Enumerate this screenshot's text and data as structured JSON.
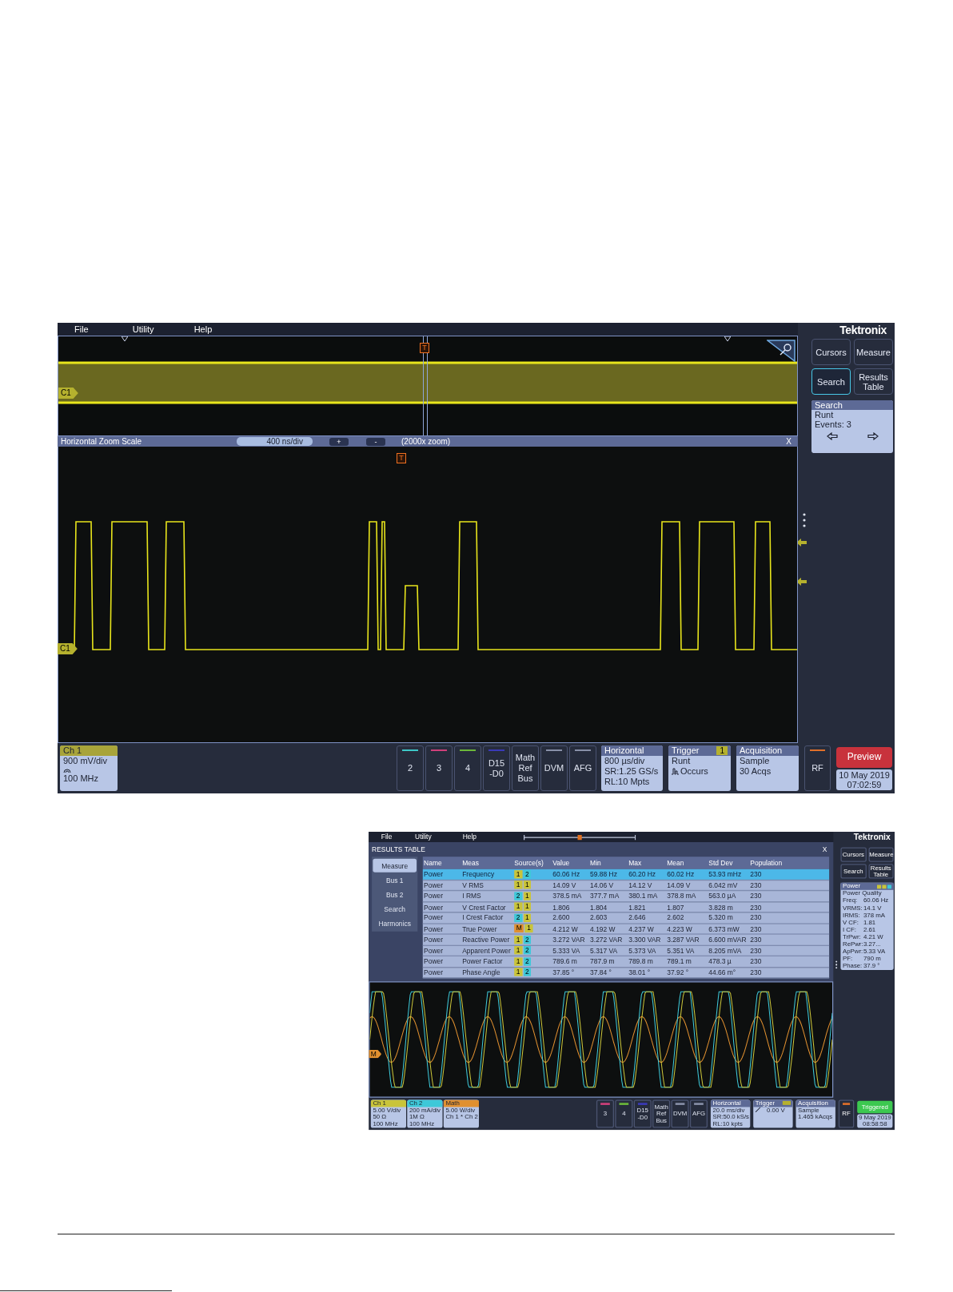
{
  "scope": {
    "menu": [
      "File",
      "Utility",
      "Help"
    ],
    "logo": "Tektronix",
    "overview": {
      "channel": "C1",
      "trigger": "T"
    },
    "zoom_bar": {
      "title": "Horizontal Zoom Scale",
      "scale": "400 ns/div",
      "plus": "+",
      "minus": "-",
      "factor": "(2000x zoom)",
      "close": "X"
    },
    "zoom": {
      "channel": "C1",
      "trigger": "T"
    },
    "side_buttons": [
      {
        "label": "Cursors",
        "selected": false
      },
      {
        "label": "Measure",
        "selected": false
      },
      {
        "label": "Search",
        "selected": true
      },
      {
        "label": "Results Table",
        "selected": false
      }
    ],
    "search_panel": {
      "title": "Search",
      "lines": [
        "Runt",
        "Events: 3"
      ]
    },
    "channel": {
      "title": "Ch 1",
      "scale": "900 mV/div",
      "bandwidth": "100 MHz"
    },
    "buttons": [
      {
        "lines": [
          "2"
        ],
        "color": "#3ec8c8"
      },
      {
        "lines": [
          "3"
        ],
        "color": "#d0407a"
      },
      {
        "lines": [
          "4"
        ],
        "color": "#6cb83a"
      },
      {
        "lines": [
          "D15",
          "-D0"
        ],
        "color": "#3a3ab8"
      },
      {
        "lines": [
          "Math",
          "Ref",
          "Bus"
        ]
      },
      {
        "lines": [
          "DVM"
        ],
        "color": "#8890a8"
      },
      {
        "lines": [
          "AFG"
        ],
        "color": "#8890a8"
      }
    ],
    "panels": [
      {
        "kind": "plain",
        "title": "Horizontal",
        "lines": [
          "800 µs/div",
          "SR:1.25 GS/s",
          "RL:10 Mpts"
        ]
      },
      {
        "kind": "trigger",
        "title": "Trigger",
        "badge": "1",
        "lines": [
          "Runt",
          "Occurs"
        ]
      },
      {
        "kind": "plain",
        "title": "Acquisition",
        "lines": [
          "Sample",
          "30 Acqs"
        ]
      }
    ],
    "rf": {
      "label": "RF",
      "color": "#e0702a"
    },
    "preview": "Preview",
    "date": "10 May 2019",
    "time": "07:02:59"
  },
  "results_screenshot": {
    "menu": [
      "File",
      "Utility",
      "Help"
    ],
    "logo": "Tektronix",
    "title": "RESULTS TABLE",
    "close": "X",
    "nav": [
      {
        "label": "Measure",
        "selected": true
      },
      {
        "label": "Bus 1",
        "selected": false
      },
      {
        "label": "Bus 2",
        "selected": false
      },
      {
        "label": "Search",
        "selected": false
      },
      {
        "label": "Harmonics",
        "selected": false
      }
    ],
    "columns": [
      "Name",
      "Meas",
      "Source(s)",
      "Value",
      "Min",
      "Max",
      "Mean",
      "Std Dev",
      "Population"
    ],
    "rows": [
      {
        "selected": true,
        "name": "Power",
        "meas": "Frequency",
        "sources": [
          {
            "label": "1",
            "color": "#c9c43a"
          },
          {
            "label": "2",
            "color": "#3ec8d8"
          }
        ],
        "value": "60.06 Hz",
        "min": "59.88 Hz",
        "max": "60.20 Hz",
        "mean": "60.02 Hz",
        "std_dev": "53.93 mHz",
        "population": "230"
      },
      {
        "selected": false,
        "name": "Power",
        "meas": "V RMS",
        "sources": [
          {
            "label": "1",
            "color": "#c9c43a"
          },
          {
            "label": "1",
            "color": "#c9c43a"
          }
        ],
        "value": "14.09 V",
        "min": "14.06 V",
        "max": "14.12 V",
        "mean": "14.09 V",
        "std_dev": "6.042 mV",
        "population": "230"
      },
      {
        "selected": false,
        "name": "Power",
        "meas": "I RMS",
        "sources": [
          {
            "label": "2",
            "color": "#3ec8d8"
          },
          {
            "label": "1",
            "color": "#c9c43a"
          }
        ],
        "value": "378.5 mA",
        "min": "377.7 mA",
        "max": "380.1 mA",
        "mean": "378.8 mA",
        "std_dev": "563.0 µA",
        "population": "230"
      },
      {
        "selected": false,
        "name": "Power",
        "meas": "V Crest Factor",
        "sources": [
          {
            "label": "1",
            "color": "#c9c43a"
          },
          {
            "label": "1",
            "color": "#c9c43a"
          }
        ],
        "value": "1.806",
        "min": "1.804",
        "max": "1.821",
        "mean": "1.807",
        "std_dev": "3.828 m",
        "population": "230"
      },
      {
        "selected": false,
        "name": "Power",
        "meas": "I Crest Factor",
        "sources": [
          {
            "label": "2",
            "color": "#3ec8d8"
          },
          {
            "label": "1",
            "color": "#c9c43a"
          }
        ],
        "value": "2.600",
        "min": "2.603",
        "max": "2.646",
        "mean": "2.602",
        "std_dev": "5.320 m",
        "population": "230"
      },
      {
        "selected": false,
        "name": "Power",
        "meas": "True Power",
        "sources": [
          {
            "label": "M",
            "color": "#e09030"
          },
          {
            "label": "1",
            "color": "#c9c43a"
          }
        ],
        "value": "4.212 W",
        "min": "4.192 W",
        "max": "4.237 W",
        "mean": "4.223 W",
        "std_dev": "6.373 mW",
        "population": "230"
      },
      {
        "selected": false,
        "name": "Power",
        "meas": "Reactive Power",
        "sources": [
          {
            "label": "1",
            "color": "#c9c43a"
          },
          {
            "label": "2",
            "color": "#3ec8d8"
          }
        ],
        "value": "3.272 VAR",
        "min": "3.272 VAR",
        "max": "3.300 VAR",
        "mean": "3.287 VAR",
        "std_dev": "6.600 mVAR",
        "population": "230"
      },
      {
        "selected": false,
        "name": "Power",
        "meas": "Apparent Power",
        "sources": [
          {
            "label": "1",
            "color": "#c9c43a"
          },
          {
            "label": "2",
            "color": "#3ec8d8"
          }
        ],
        "value": "5.333 VA",
        "min": "5.317 VA",
        "max": "5.373 VA",
        "mean": "5.351 VA",
        "std_dev": "8.205 mVA",
        "population": "230"
      },
      {
        "selected": false,
        "name": "Power",
        "meas": "Power Factor",
        "sources": [
          {
            "label": "1",
            "color": "#c9c43a"
          },
          {
            "label": "2",
            "color": "#3ec8d8"
          }
        ],
        "value": "789.6 m",
        "min": "787.9 m",
        "max": "789.8 m",
        "mean": "789.1 m",
        "std_dev": "478.3 µ",
        "population": "230"
      },
      {
        "selected": false,
        "name": "Power",
        "meas": "Phase Angle",
        "sources": [
          {
            "label": "1",
            "color": "#c9c43a"
          },
          {
            "label": "2",
            "color": "#3ec8d8"
          }
        ],
        "value": "37.85 °",
        "min": "37.84 °",
        "max": "38.01 °",
        "mean": "37.92 °",
        "std_dev": "44.66 m°",
        "population": "230"
      }
    ],
    "side_buttons": [
      "Cursors",
      "Measure",
      "Search",
      "Results Table"
    ],
    "power_panel": {
      "title": "Power",
      "heading": "Power Quality",
      "readings": [
        {
          "label": "Freq:",
          "value": "60.06 Hz"
        },
        {
          "label": "VRMS:",
          "value": "14.1 V"
        },
        {
          "label": "IRMS:",
          "value": "378 mA"
        },
        {
          "label": "V CF:",
          "value": "1.81"
        },
        {
          "label": "I CF:",
          "value": "2.61"
        },
        {
          "label": "TrPwr:",
          "value": "4.21 W"
        },
        {
          "label": "RePwr:",
          "value": "3.27..."
        },
        {
          "label": "ApPwr:",
          "value": "5.33 VA"
        },
        {
          "label": "PF:",
          "value": "790 m"
        },
        {
          "label": "Phase:",
          "value": "37.9 °"
        }
      ]
    },
    "wave_marker": "M",
    "channels": [
      {
        "title": "Ch 1",
        "color": "#c9c43a",
        "lines": [
          "5.00 V/div",
          "50 Ω",
          "100 MHz"
        ]
      },
      {
        "title": "Ch 2",
        "color": "#3ec8d8",
        "lines": [
          "200 mA/div",
          "1M Ω",
          "100 MHz"
        ]
      },
      {
        "title": "Math",
        "color": "#e09030",
        "lines": [
          "5.00 W/div",
          "Ch 1 * Ch 2"
        ]
      }
    ],
    "buttons": [
      {
        "lines": [
          "3"
        ],
        "color": "#d0407a"
      },
      {
        "lines": [
          "4"
        ],
        "color": "#6cb83a"
      },
      {
        "lines": [
          "D15",
          "-D0"
        ],
        "color": "#3a3ab8"
      },
      {
        "lines": [
          "Math",
          "Ref",
          "Bus"
        ]
      },
      {
        "lines": [
          "DVM"
        ],
        "color": "#8890a8"
      },
      {
        "lines": [
          "AFG"
        ],
        "color": "#8890a8"
      }
    ],
    "panels": [
      {
        "kind": "plain",
        "title": "Horizontal",
        "lines": [
          "20.0 ms/div",
          "SR:50.0 kS/s",
          "RL:10 kpts"
        ]
      },
      {
        "kind": "trigger",
        "title": "Trigger",
        "lines": [
          "0.00 V"
        ]
      },
      {
        "kind": "plain",
        "title": "Acquisition",
        "lines": [
          "Sample",
          "1.465 kAcqs"
        ]
      }
    ],
    "rf": {
      "label": "RF",
      "color": "#e0702a"
    },
    "status": "Triggered",
    "date": "9 May 2019",
    "time": "08:58:58"
  }
}
